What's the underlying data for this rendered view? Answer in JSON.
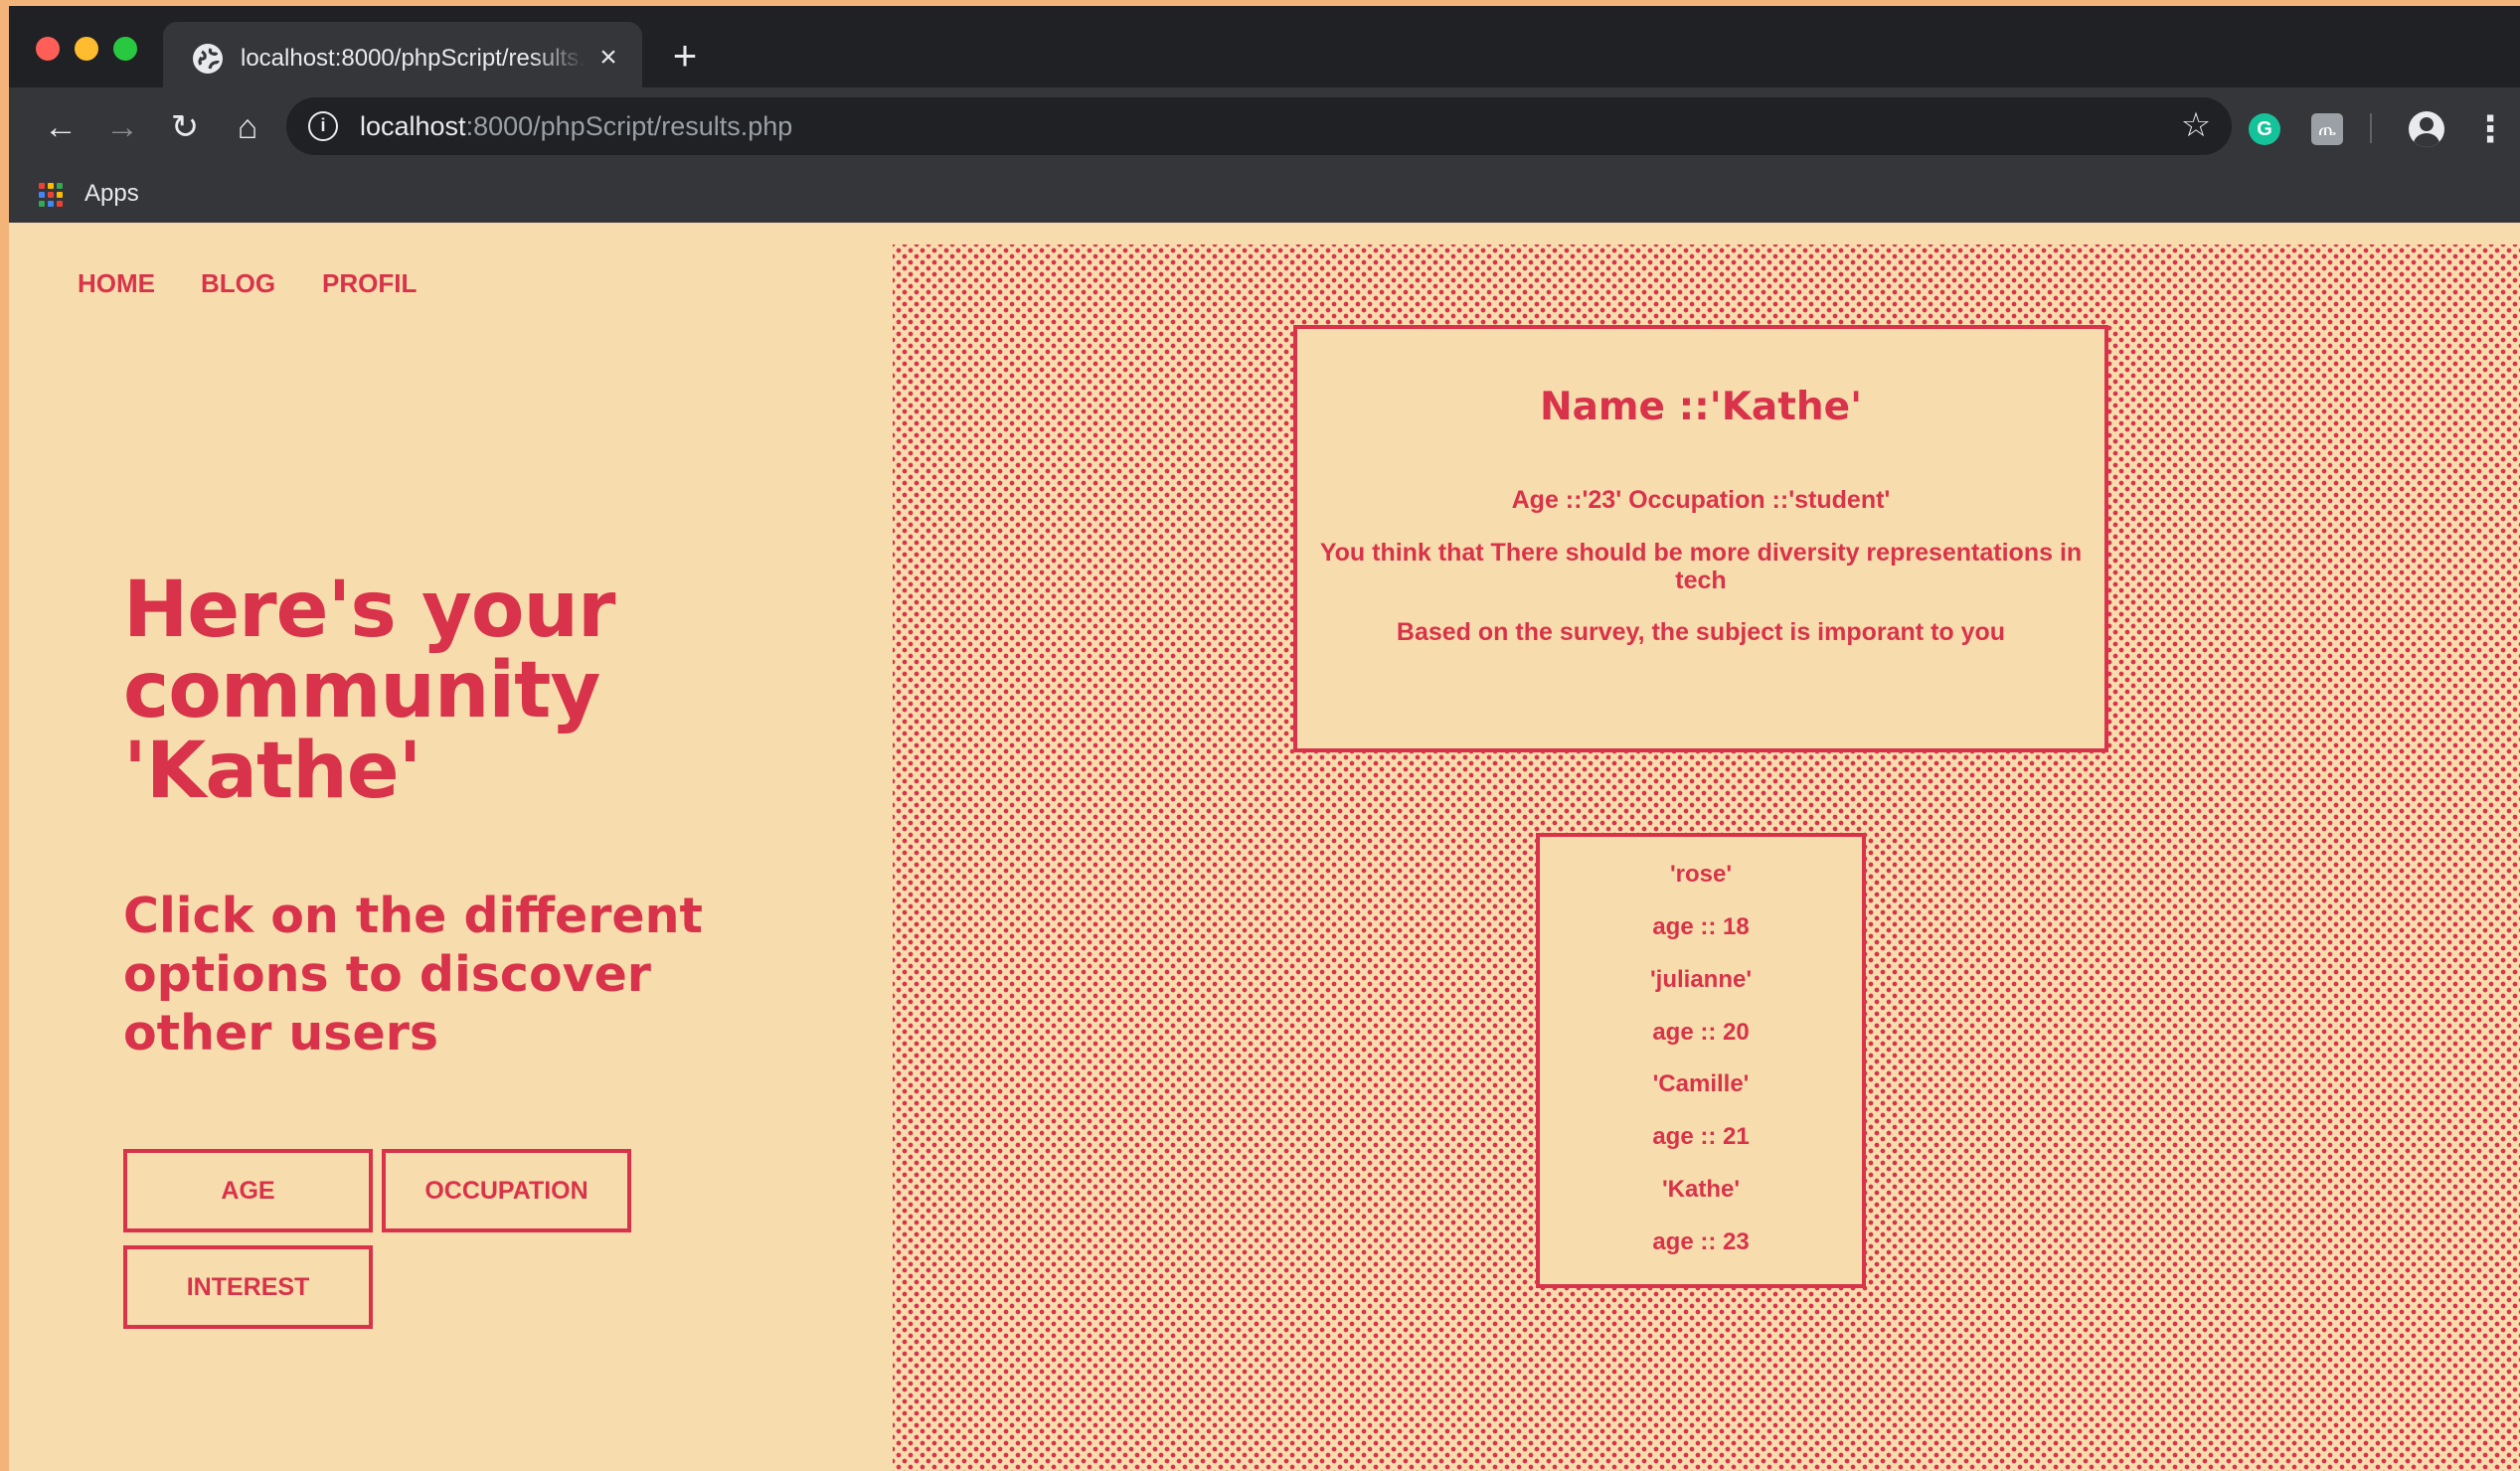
{
  "browser": {
    "tab_title": "localhost:8000/phpScript/results.php",
    "url_host": "localhost",
    "url_rest": ":8000/phpScript/results.php",
    "bookmarks_apps_label": "Apps"
  },
  "nav": {
    "items": [
      "HOME",
      "BLOG",
      "PROFIL"
    ]
  },
  "hero": {
    "headline_line1": "Here's your",
    "headline_line2": "community",
    "headline_line3": "'Kathe'",
    "subheadline_line1": "Click on the different",
    "subheadline_line2": "options to discover",
    "subheadline_line3": "other users"
  },
  "options": {
    "age": "AGE",
    "occupation": "OCCUPATION",
    "interest": "INTEREST"
  },
  "profile": {
    "name": "Name ::'Kathe'",
    "age_occupation": "Age ::'23' Occupation ::'student'",
    "opinion_line1": "You think that There should be more diversity representations in",
    "opinion_line2": "tech",
    "survey": "Based on the survey, the subject is imporant to you"
  },
  "users": [
    {
      "name": "'rose'",
      "age": "age :: 18"
    },
    {
      "name": "'julianne'",
      "age": "age :: 20"
    },
    {
      "name": "'Camille'",
      "age": "age :: 21"
    },
    {
      "name": "'Kathe'",
      "age": "age :: 23"
    }
  ],
  "colors": {
    "accent": "#d8334a",
    "page_bg": "#f7dcad",
    "browser_dark": "#202124"
  }
}
